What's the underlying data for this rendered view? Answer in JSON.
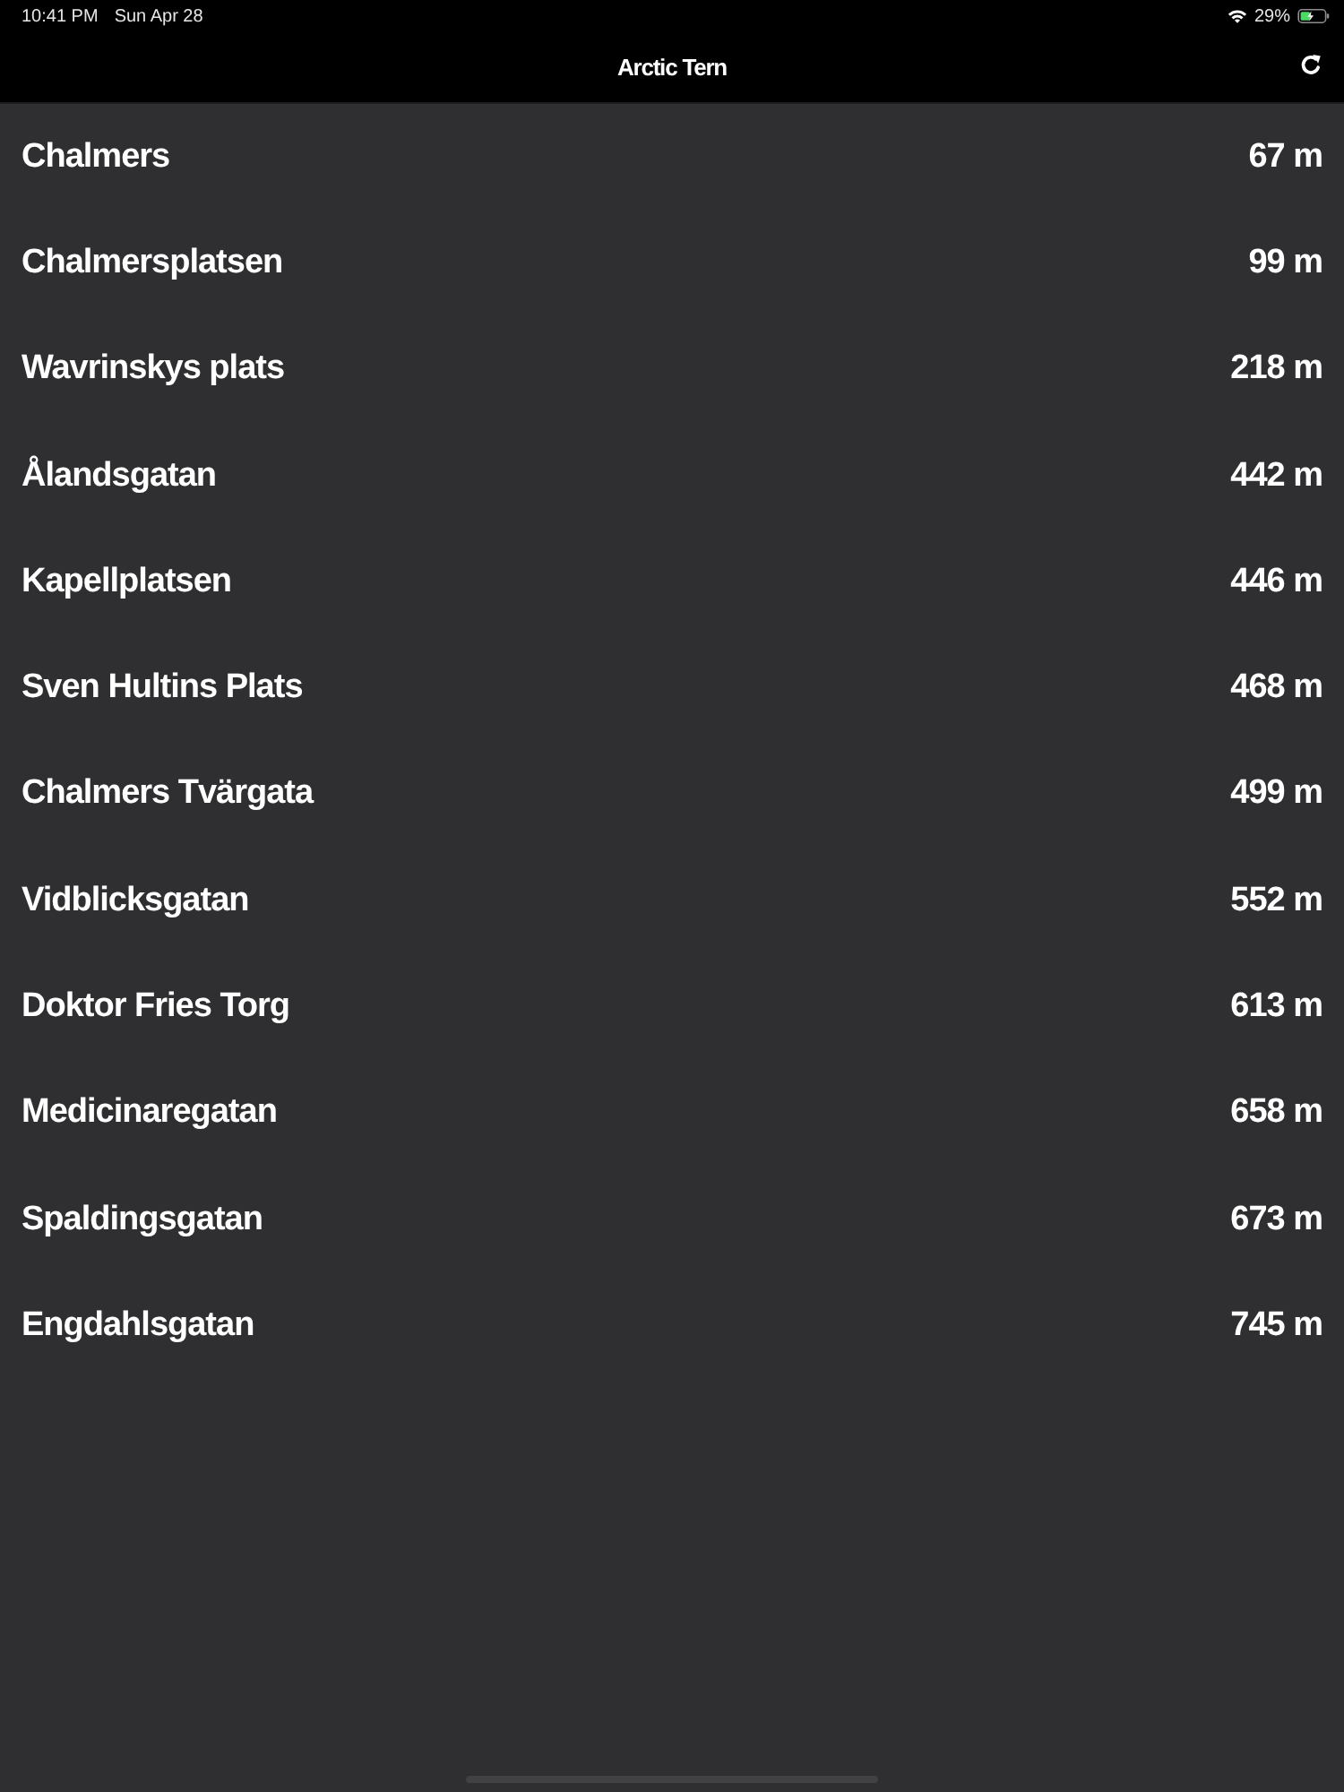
{
  "status_bar": {
    "time": "10:41 PM",
    "date": "Sun Apr 28",
    "battery": "29%"
  },
  "nav_bar": {
    "title": "Arctic Tern"
  },
  "stops": [
    {
      "name": "Chalmers",
      "distance": "67 m"
    },
    {
      "name": "Chalmersplatsen",
      "distance": "99 m"
    },
    {
      "name": "Wavrinskys plats",
      "distance": "218 m"
    },
    {
      "name": "Ålandsgatan",
      "distance": "442 m"
    },
    {
      "name": "Kapellplatsen",
      "distance": "446 m"
    },
    {
      "name": "Sven Hultins Plats",
      "distance": "468 m"
    },
    {
      "name": "Chalmers Tvärgata",
      "distance": "499 m"
    },
    {
      "name": "Vidblicksgatan",
      "distance": "552 m"
    },
    {
      "name": "Doktor Fries Torg",
      "distance": "613 m"
    },
    {
      "name": "Medicinaregatan",
      "distance": "658 m"
    },
    {
      "name": "Spaldingsgatan",
      "distance": "673 m"
    },
    {
      "name": "Engdahlsgatan",
      "distance": "745 m"
    }
  ]
}
